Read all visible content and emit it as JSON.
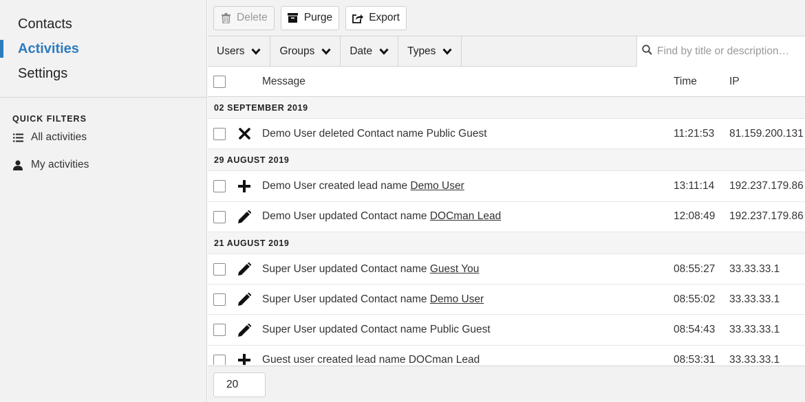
{
  "sidebar": {
    "nav": [
      {
        "label": "Contacts",
        "active": false
      },
      {
        "label": "Activities",
        "active": true
      },
      {
        "label": "Settings",
        "active": false
      }
    ],
    "quick_filters_heading": "QUICK FILTERS",
    "quick_filters": [
      {
        "label": "All activities",
        "icon": "list-icon"
      },
      {
        "label": "My activities",
        "icon": "user-icon"
      }
    ],
    "accent_color": "#2e7bbf"
  },
  "toolbar": {
    "delete_label": "Delete",
    "purge_label": "Purge",
    "export_label": "Export"
  },
  "filters": {
    "users": "Users",
    "groups": "Groups",
    "date": "Date",
    "types": "Types",
    "search_placeholder": "Find by title or description…"
  },
  "table": {
    "headers": {
      "message": "Message",
      "time": "Time",
      "ip": "IP"
    },
    "groups": [
      {
        "date": "02 SEPTEMBER 2019",
        "rows": [
          {
            "icon": "delete-x-icon",
            "text": "Demo User deleted Contact name Public Guest",
            "link": "",
            "time": "11:21:53",
            "ip": "81.159.200.131"
          }
        ]
      },
      {
        "date": "29 AUGUST 2019",
        "rows": [
          {
            "icon": "plus-icon",
            "text": "Demo User created lead name ",
            "link": "Demo User",
            "time": "13:11:14",
            "ip": "192.237.179.86"
          },
          {
            "icon": "pencil-icon",
            "text": "Demo User updated Contact name ",
            "link": "DOCman Lead",
            "time": "12:08:49",
            "ip": "192.237.179.86"
          }
        ]
      },
      {
        "date": "21 AUGUST 2019",
        "rows": [
          {
            "icon": "pencil-icon",
            "text": "Super User updated Contact name ",
            "link": "Guest You",
            "time": "08:55:27",
            "ip": "33.33.33.1"
          },
          {
            "icon": "pencil-icon",
            "text": "Super User updated Contact name ",
            "link": "Demo User",
            "time": "08:55:02",
            "ip": "33.33.33.1"
          },
          {
            "icon": "pencil-icon",
            "text": "Super User updated Contact name Public Guest",
            "link": "",
            "time": "08:54:43",
            "ip": "33.33.33.1"
          },
          {
            "icon": "plus-icon",
            "text": "Guest user created lead name DOCman Lead",
            "link": "",
            "time": "08:53:31",
            "ip": "33.33.33.1"
          }
        ]
      }
    ]
  },
  "pagination": {
    "limit": "20"
  }
}
